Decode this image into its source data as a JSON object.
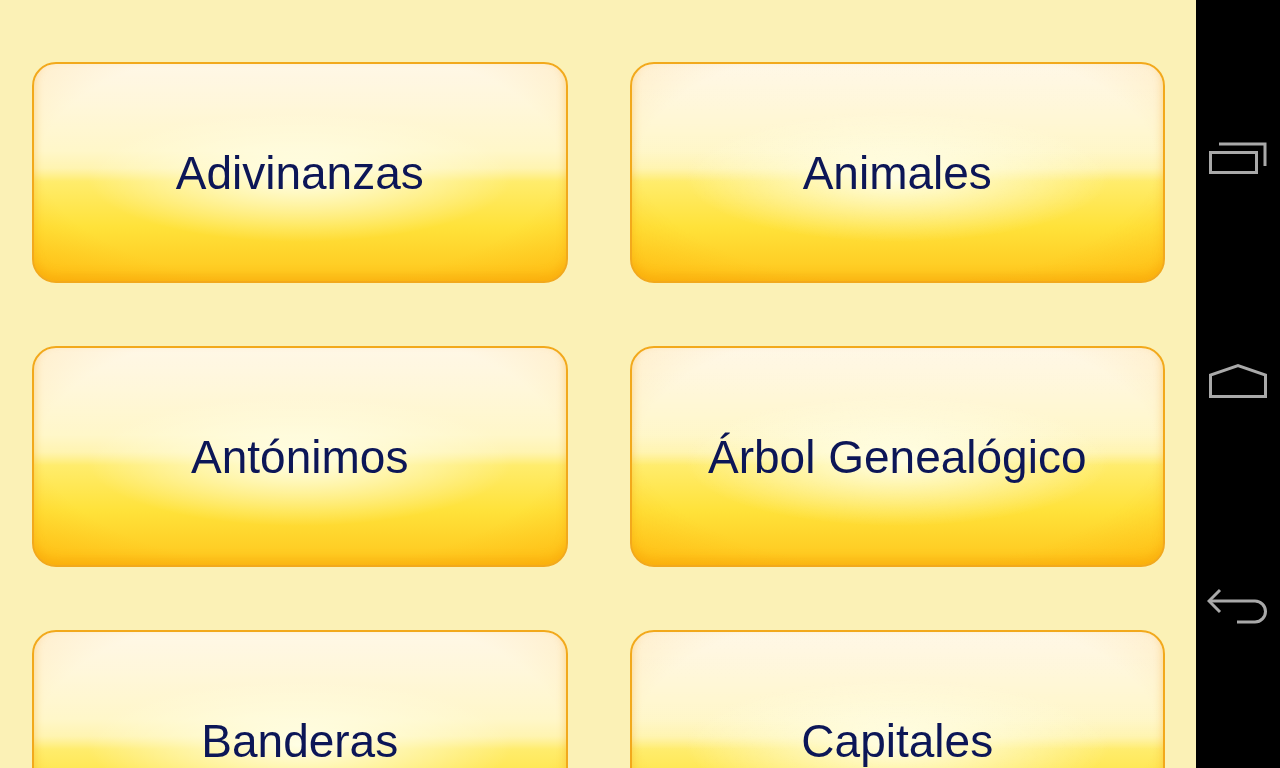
{
  "topics": [
    {
      "label": "Adivinanzas"
    },
    {
      "label": "Animales"
    },
    {
      "label": "Antónimos"
    },
    {
      "label": "Árbol Genealógico"
    },
    {
      "label": "Banderas"
    },
    {
      "label": "Capitales"
    }
  ]
}
